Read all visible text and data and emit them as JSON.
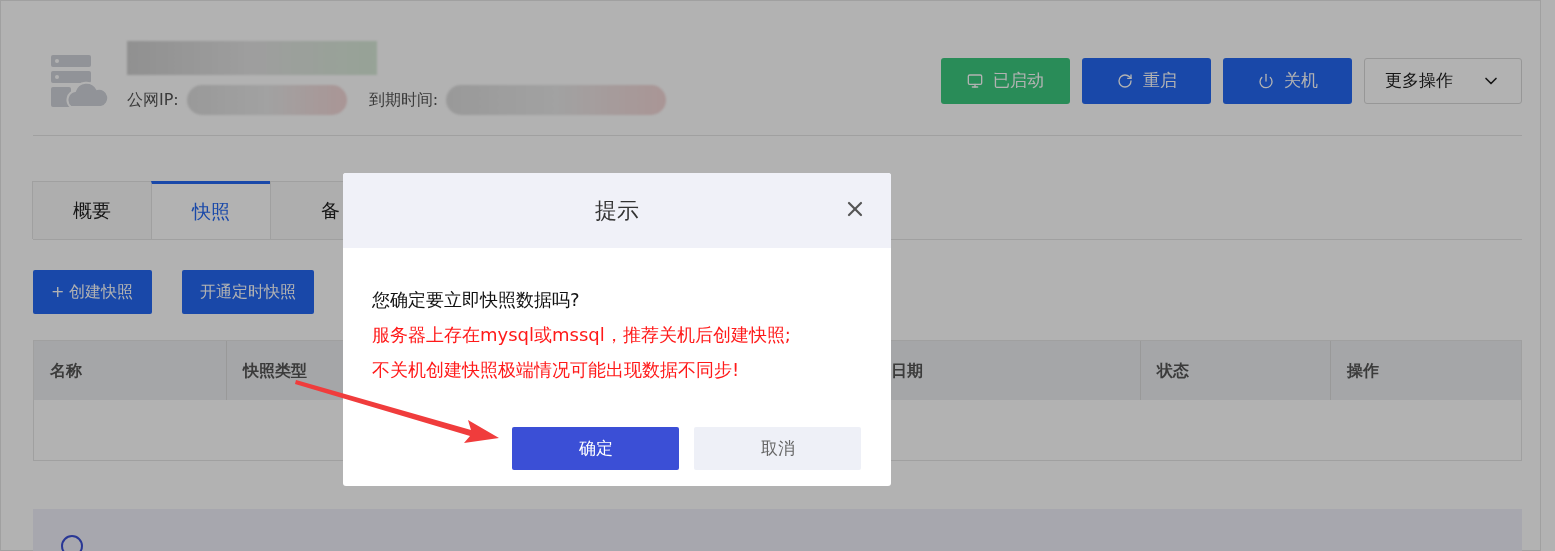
{
  "server": {
    "ip_label": "公网IP:",
    "expiry_label": "到期时间:"
  },
  "actions": [
    {
      "kind": "status",
      "label": "已启动"
    },
    {
      "kind": "restart",
      "label": "重启"
    },
    {
      "kind": "shutdown",
      "label": "关机"
    },
    {
      "kind": "more",
      "label": "更多操作"
    }
  ],
  "tabs": [
    {
      "label": "概要",
      "selected": false
    },
    {
      "label": "快照",
      "selected": true
    },
    {
      "label": "备",
      "selected": false
    }
  ],
  "toolbar": [
    "+ 创建快照",
    "开通定时快照"
  ],
  "table": {
    "columns": [
      "名称",
      "快照类型",
      "日期",
      "状态",
      "操作"
    ]
  },
  "dialog": {
    "title": "提示",
    "question": "您确定要立即快照数据吗?",
    "warnings": [
      "服务器上存在mysql或mssql，推荐关机后创建快照;",
      "不关机创建快照极端情况可能出现数据不同步!"
    ],
    "confirm": "确定",
    "cancel": "取消"
  }
}
